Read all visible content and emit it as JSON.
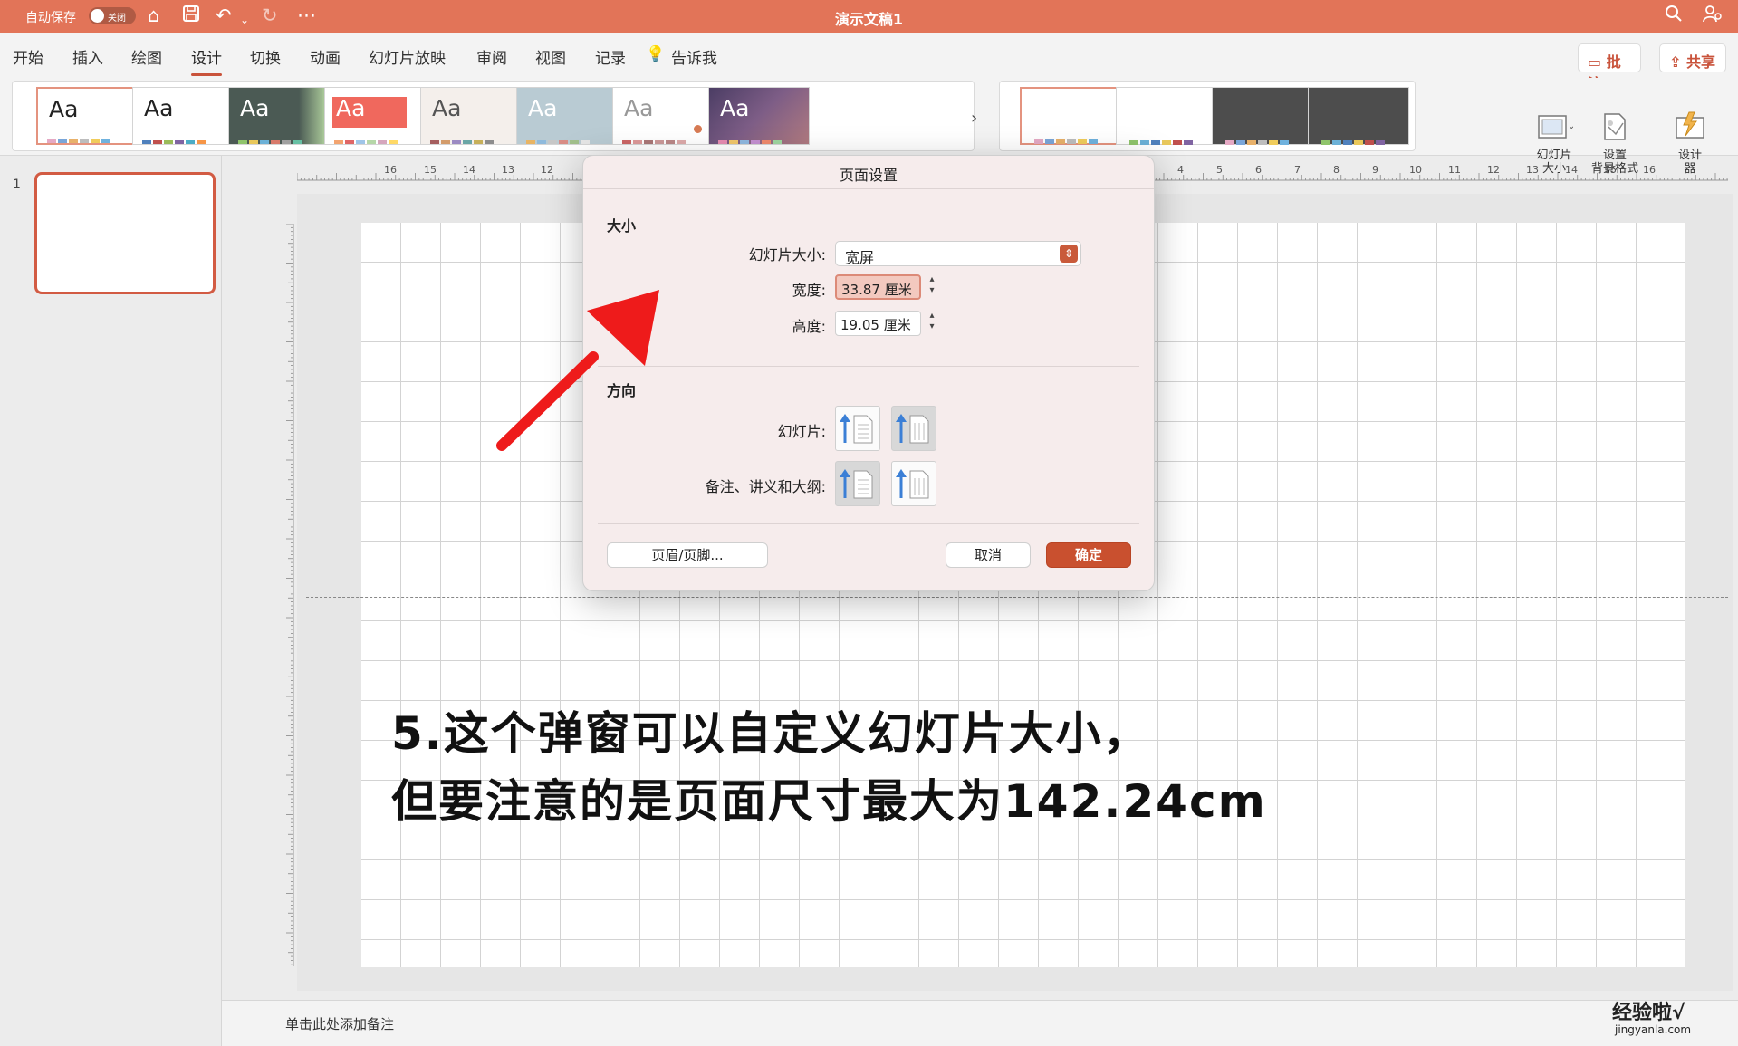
{
  "titlebar": {
    "autosave_label": "自动保存",
    "toggle_label": "关闭",
    "title": "演示文稿1"
  },
  "menu": {
    "items": [
      "开始",
      "插入",
      "绘图",
      "设计",
      "切换",
      "动画",
      "幻灯片放映",
      "审阅",
      "视图",
      "记录"
    ],
    "active": "设计",
    "tell_me": "告诉我",
    "comments": "批注",
    "share": "共享"
  },
  "ribbon": {
    "theme_thumb_label": "Aa",
    "slide_size": "幻灯片\n大小",
    "format_background": "设置\n背景格式",
    "designer": "设计\n器"
  },
  "thumbnails": {
    "slide_number": "1"
  },
  "dialog": {
    "title": "页面设置",
    "size_section": "大小",
    "slide_size_label": "幻灯片大小:",
    "slide_size_value": "宽屏",
    "width_label": "宽度:",
    "width_value": "33.87 厘米",
    "height_label": "高度:",
    "height_value": "19.05 厘米",
    "orientation_section": "方向",
    "slides_label": "幻灯片:",
    "notes_label": "备注、讲义和大纲:",
    "header_footer_button": "页眉/页脚...",
    "cancel_button": "取消",
    "ok_button": "确定"
  },
  "slide": {
    "annotation_line1": "5.这个弹窗可以自定义幻灯片大小，",
    "annotation_line2": "但要注意的是页面尺寸最大为142.24cm"
  },
  "ruler": {
    "top_left": [
      "16",
      "15",
      "14",
      "13",
      "12"
    ],
    "top_right": [
      "4",
      "5",
      "6",
      "7",
      "8",
      "9",
      "10",
      "11",
      "12",
      "13",
      "14",
      "15",
      "16"
    ]
  },
  "notes": {
    "placeholder": "单击此处添加备注"
  },
  "watermark": {
    "main": "经验啦√",
    "sub": "jingyanla.com"
  },
  "colors": {
    "accent": "#e27458",
    "primary_button": "#c9502f",
    "arrow": "#ee1b1b"
  }
}
